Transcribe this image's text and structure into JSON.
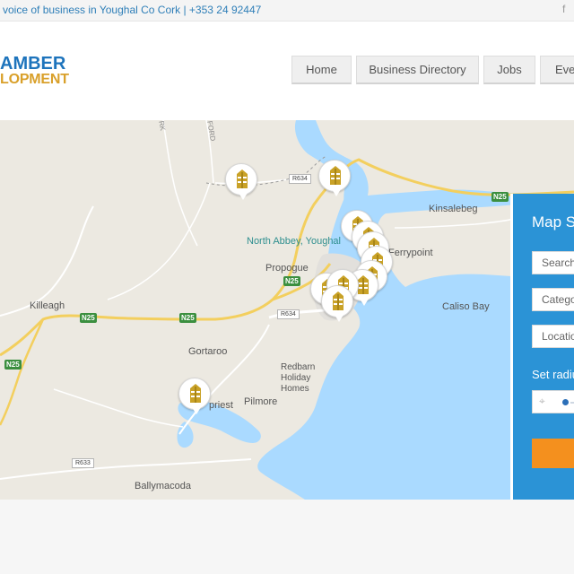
{
  "topbar": {
    "tagline": "voice of business in Youghal Co Cork | +353 24 92447",
    "facebook_glyph": "f"
  },
  "logo": {
    "line1": "AMBER",
    "line2": "LOPMENT"
  },
  "nav": {
    "items": [
      "Home",
      "Business Directory",
      "Jobs",
      "Eve"
    ]
  },
  "map": {
    "places": {
      "north_abbey": "North Abbey, Youghal",
      "ferrypoint": "Ferrypoint",
      "kinsalebeg": "Kinsalebeg",
      "propogue": "Propogue",
      "killeagh": "Killeagh",
      "gortaroo": "Gortaroo",
      "caliso_bay": "Caliso Bay",
      "redbarn": "Redbarn\nHoliday\nHomes",
      "pilmore": "Pilmore",
      "priest": "priest",
      "ballymacoda": "Ballymacoda",
      "road_rk": "RK",
      "road_ford": "FORD"
    },
    "roads": {
      "r634_top": "R634",
      "r634_mid": "R634",
      "r633": "R633",
      "n25_a": "N25",
      "n25_b": "N25",
      "n25_c": "N25",
      "n25_d": "N25",
      "n25_e": "N25"
    },
    "colors": {
      "land": "#ece9e1",
      "water": "#aadaff",
      "road_major": "#f7d36a",
      "road_minor": "#ffffff",
      "pin_icon": "#c9a227"
    }
  },
  "panel": {
    "title": "Map S",
    "search_placeholder": "Search",
    "category_placeholder": "Catego",
    "location_placeholder": "Location",
    "radius_label": "Set radiu",
    "accent": "#2b93d6",
    "button_color": "#f4901e"
  }
}
